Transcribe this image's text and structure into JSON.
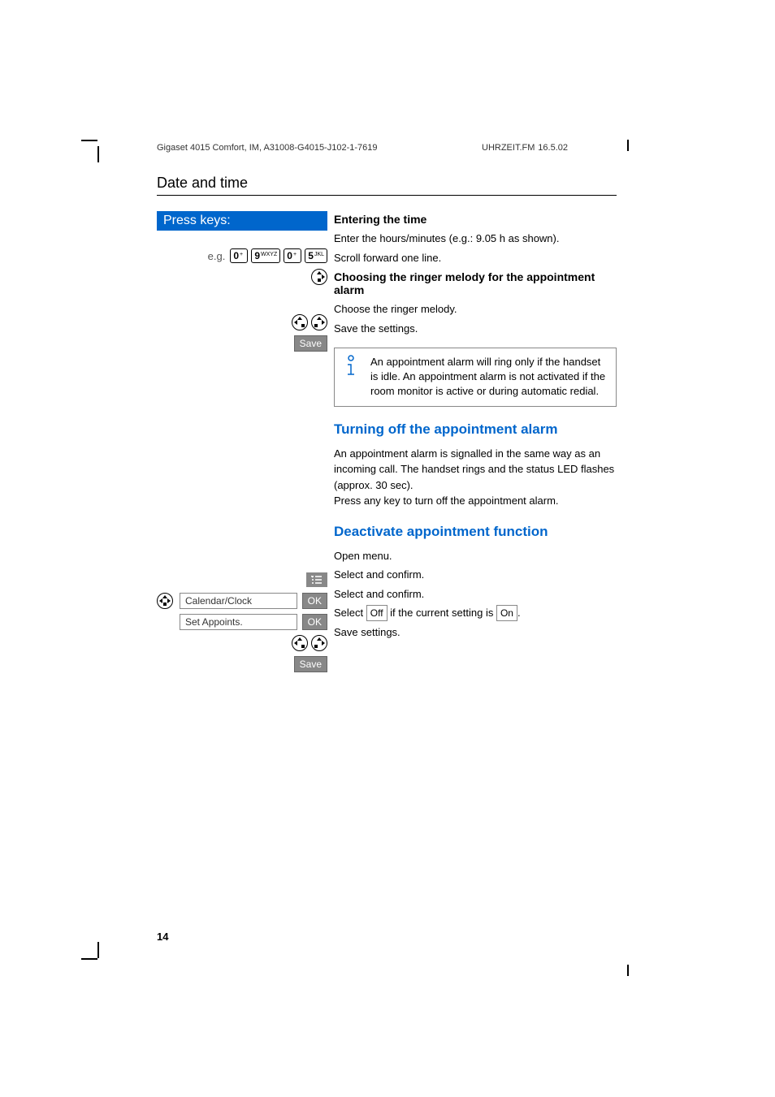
{
  "header": {
    "left": "Gigaset 4015 Comfort, IM, A31008-G4015-J102-1-7619",
    "center": "UHRZEIT.FM",
    "right": "16.5.02"
  },
  "section_title": "Date and time",
  "press_keys_label": "Press keys:",
  "eg": "e.g.",
  "keys": {
    "zero": "0",
    "zero_sup": "+",
    "nine": "9",
    "nine_sup": "WXYZ",
    "five": "5",
    "five_sup": "JKL"
  },
  "softkeys": {
    "save": "Save",
    "ok": "OK"
  },
  "menu": {
    "calendar": "Calendar/Clock",
    "set_appoints": "Set Appoints."
  },
  "headings": {
    "entering_time": "Entering the time",
    "choosing_ringer": "Choosing the ringer melody for the appointment alarm",
    "turning_off": "Turning off the appointment alarm",
    "deactivate": "Deactivate appointment function"
  },
  "lines": {
    "enter_hours": "Enter the hours/minutes (e.g.: 9.05 h as shown).",
    "scroll_forward": "Scroll forward one line.",
    "choose_ringer": "Choose the ringer melody.",
    "save_settings": "Save the settings.",
    "note": "An appointment alarm will ring only if the handset is idle. An appointment alarm is not activated if the room monitor is active or during automatic redial.",
    "turning_off_para": "An appointment alarm is signalled in the same way as an incoming call. The handset rings and the status LED flashes (approx. 30 sec).\nPress any key to turn off the appointment alarm.",
    "open_menu": "Open menu.",
    "select_confirm": "Select and confirm.",
    "select_off_pre": "Select ",
    "select_off_mid": " if the current setting is ",
    "select_off_post": ".",
    "off": "Off",
    "on": "On",
    "save_settings2": "Save settings."
  },
  "page_number": "14"
}
